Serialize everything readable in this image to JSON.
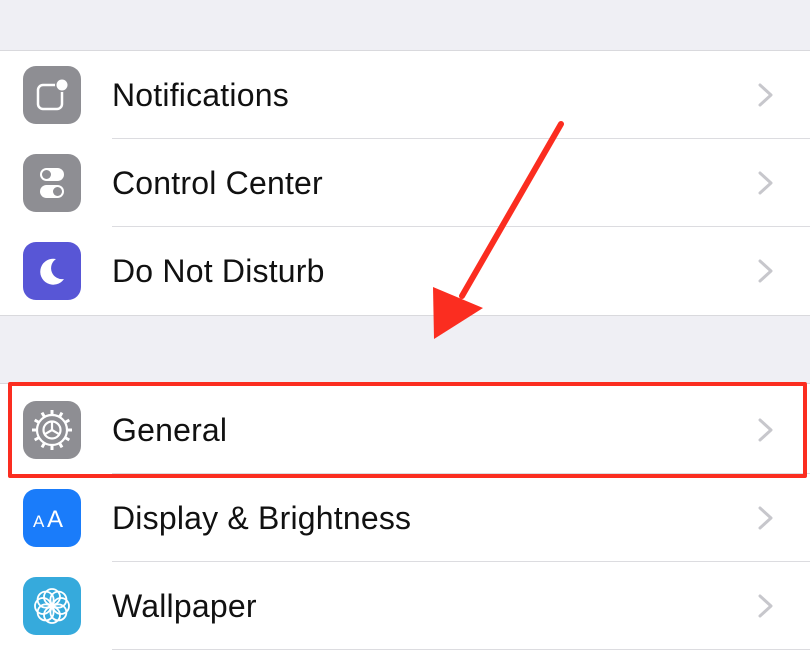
{
  "settings": {
    "group1": [
      {
        "label": "Notifications",
        "icon": "notifications-icon",
        "color": "#8e8e93"
      },
      {
        "label": "Control Center",
        "icon": "control-center-icon",
        "color": "#8e8e93"
      },
      {
        "label": "Do Not Disturb",
        "icon": "moon-icon",
        "color": "#5856d6"
      }
    ],
    "group2": [
      {
        "label": "General",
        "icon": "gear-icon",
        "color": "#8e8e93"
      },
      {
        "label": "Display & Brightness",
        "icon": "text-size-icon",
        "color": "#1a7cfa",
        "icon_text": "AA"
      },
      {
        "label": "Wallpaper",
        "icon": "flower-icon",
        "color": "#36aadc"
      }
    ]
  },
  "annotation": {
    "highlight_color": "#fb2d20",
    "arrow_color": "#fb2d20",
    "target": "General"
  }
}
